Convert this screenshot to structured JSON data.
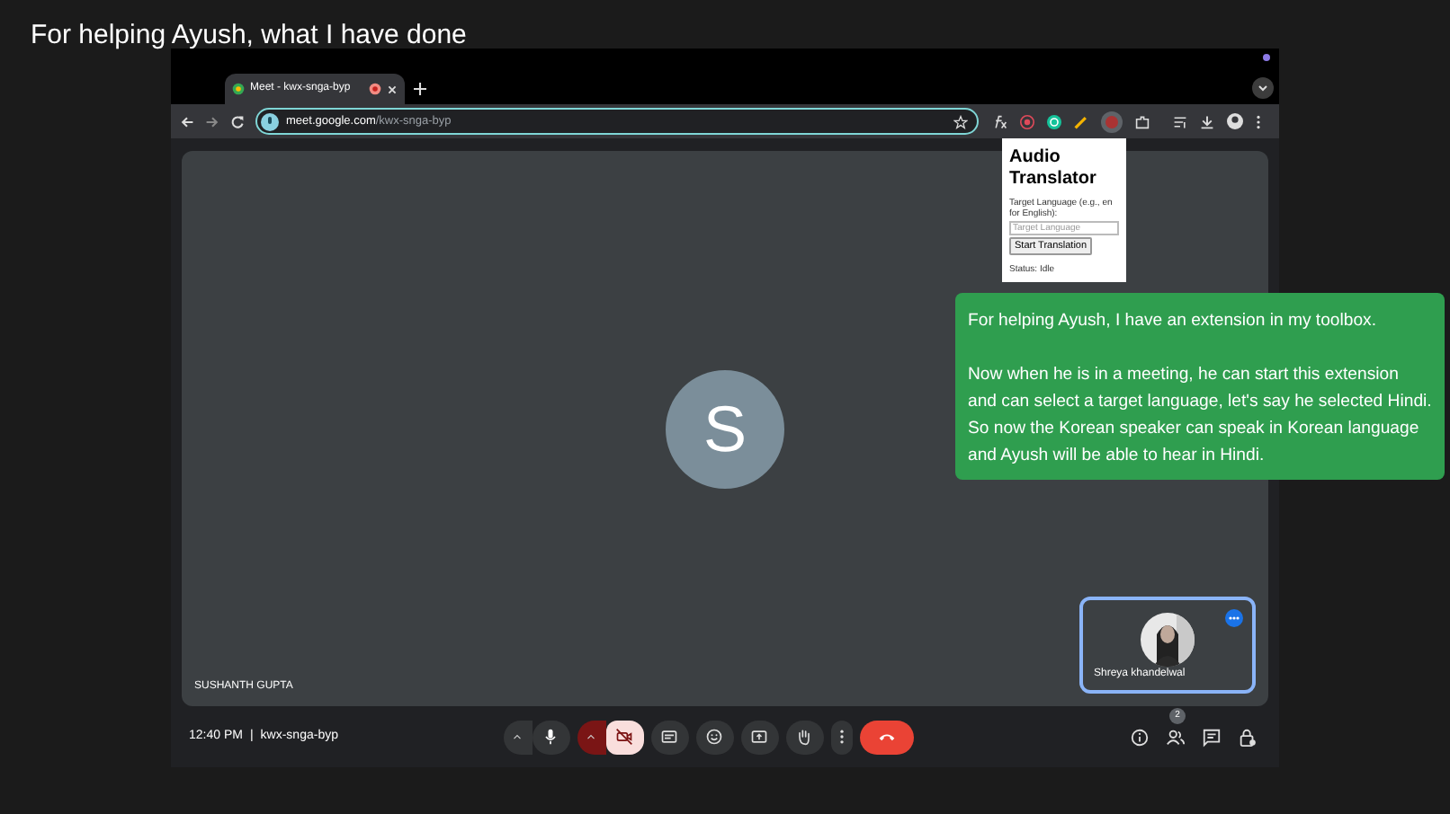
{
  "heading": "For helping Ayush, what I have done",
  "browser": {
    "tab": {
      "title": "Meet - kwx-snga-byp"
    },
    "address": {
      "domain": "meet.google.com",
      "path": "/kwx-snga-byp"
    }
  },
  "popup": {
    "title": "Audio Translator",
    "label": "Target Language (e.g., en for English):",
    "placeholder": "Target Language",
    "button": "Start Translation",
    "status": "Status: Idle"
  },
  "meeting": {
    "main_tile": {
      "initial": "S",
      "name": "SUSHANTH GUPTA"
    },
    "self_tile": {
      "name": "Shreya khandelwal",
      "selected": true
    },
    "time": "12:40 PM",
    "separator": "|",
    "code": "kwx-snga-byp",
    "controls": [
      {
        "kind": "caret",
        "muted": false
      },
      {
        "kind": "mic",
        "muted": false
      },
      {
        "kind": "caret",
        "muted": true
      },
      {
        "kind": "camera",
        "muted": true
      },
      {
        "kind": "captions",
        "muted": false
      },
      {
        "kind": "emoji",
        "muted": false
      },
      {
        "kind": "present",
        "muted": false
      },
      {
        "kind": "hand",
        "muted": false
      },
      {
        "kind": "more",
        "muted": false
      },
      {
        "kind": "hangup",
        "muted": false
      }
    ],
    "side_buttons": [
      {
        "kind": "info"
      },
      {
        "kind": "people",
        "badge": "2"
      },
      {
        "kind": "chat"
      },
      {
        "kind": "lock"
      }
    ]
  },
  "note": {
    "paragraphs": [
      "For helping Ayush, I have an extension in my toolbox.",
      "Now when he is in a meeting, he can start this extension and can select a target language, let's say he selected Hindi. So now the Korean speaker can speak in Korean language and Ayush will be able to hear in Hindi."
    ]
  }
}
